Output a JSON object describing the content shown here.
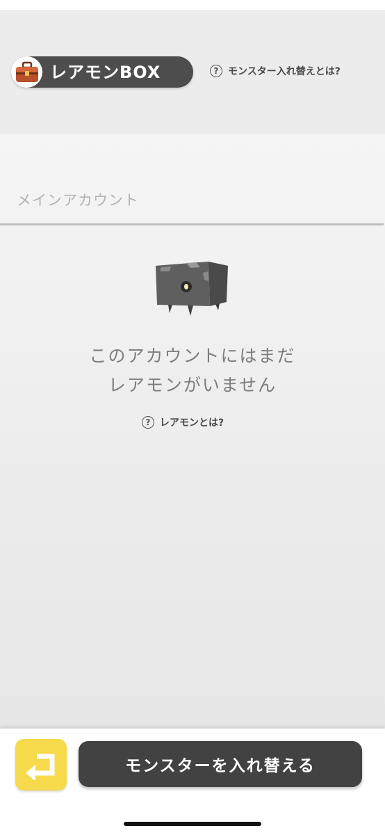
{
  "header": {
    "title": "レアモンBOX",
    "title_icon": "toolbox-icon",
    "swap_help": {
      "icon": "question-circle-icon",
      "glyph": "?",
      "label": "モンスター入れ替えとは?"
    }
  },
  "account": {
    "label": "メインアカウント"
  },
  "empty_state": {
    "image": "box-monster-icon",
    "line1": "このアカウントにはまだ",
    "line2": "レアモンがいません",
    "help": {
      "icon": "question-circle-icon",
      "glyph": "?",
      "label": "レアモンとは?"
    }
  },
  "footer": {
    "back_icon": "return-arrow-icon",
    "swap_button_label": "モンスターを入れ替える"
  },
  "colors": {
    "title_pill": "#4d4d4d",
    "back_button": "#f7d94c",
    "primary_button": "#424242",
    "muted_text": "#7d7d7d"
  }
}
